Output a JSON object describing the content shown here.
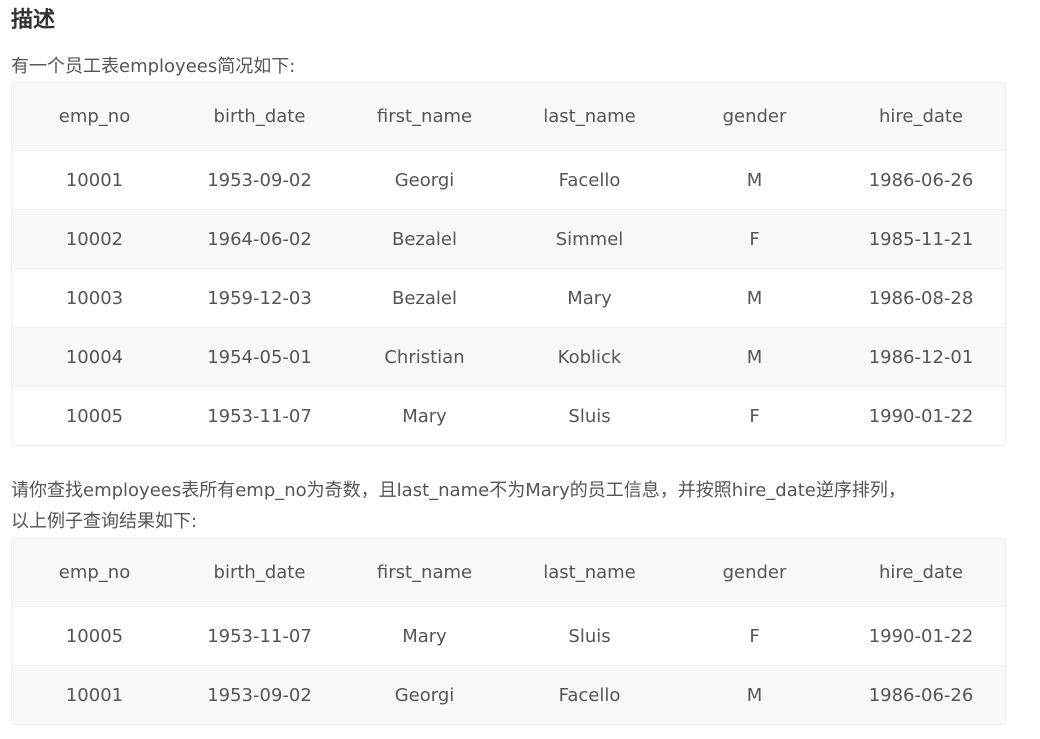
{
  "heading": "描述",
  "intro": "有一个员工表employees简况如下:",
  "question_line1": "请你查找employees表所有emp_no为奇数，且last_name不为Mary的员工信息，并按照hire_date逆序排列，",
  "question_line2": "以上例子查询结果如下:",
  "columns": [
    "emp_no",
    "birth_date",
    "first_name",
    "last_name",
    "gender",
    "hire_date"
  ],
  "employees_table": {
    "rows": [
      [
        "10001",
        "1953-09-02",
        "Georgi",
        "Facello",
        "M",
        "1986-06-26"
      ],
      [
        "10002",
        "1964-06-02",
        "Bezalel",
        "Simmel",
        "F",
        "1985-11-21"
      ],
      [
        "10003",
        "1959-12-03",
        "Bezalel",
        "Mary",
        "M",
        "1986-08-28"
      ],
      [
        "10004",
        "1954-05-01",
        "Christian",
        "Koblick",
        "M",
        "1986-12-01"
      ],
      [
        "10005",
        "1953-11-07",
        "Mary",
        "Sluis",
        "F",
        "1990-01-22"
      ]
    ]
  },
  "result_table": {
    "rows": [
      [
        "10005",
        "1953-11-07",
        "Mary",
        "Sluis",
        "F",
        "1990-01-22"
      ],
      [
        "10001",
        "1953-09-02",
        "Georgi",
        "Facello",
        "M",
        "1986-06-26"
      ]
    ]
  }
}
